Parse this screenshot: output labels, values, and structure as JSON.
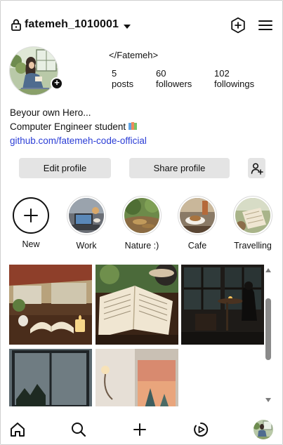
{
  "header": {
    "username": "fatemeh_1010001",
    "lock_icon": "lock-icon",
    "dropdown_icon": "caret-down-icon",
    "new_post_icon": "add-circle-icon",
    "menu_icon": "hamburger-menu-icon"
  },
  "profile": {
    "display_name": "</Fatemeh>",
    "stats": [
      {
        "value": "5",
        "label": "posts"
      },
      {
        "value": "60",
        "label": "followers"
      },
      {
        "value": "102",
        "label": "followings"
      }
    ],
    "bio": {
      "line1": "Beyour own Hero...",
      "line2": "Computer Engineer student",
      "link": "github.com/fatemeh-code-official"
    }
  },
  "actions": {
    "edit_profile": "Edit profile",
    "share_profile": "Share profile",
    "add_user_icon": "add-user-icon"
  },
  "highlights": [
    {
      "label": "New",
      "icon": "plus-icon"
    },
    {
      "label": "Work"
    },
    {
      "label": "Nature :)"
    },
    {
      "label": "Cafe"
    },
    {
      "label": "Travelling"
    }
  ],
  "bottom_nav": [
    {
      "icon": "home-icon"
    },
    {
      "icon": "search-icon"
    },
    {
      "icon": "plus-icon"
    },
    {
      "icon": "reels-icon"
    },
    {
      "icon": "profile-avatar"
    }
  ],
  "colors": {
    "link": "#2c3ed6",
    "button_bg": "#e4e4e4",
    "text": "#111111"
  }
}
